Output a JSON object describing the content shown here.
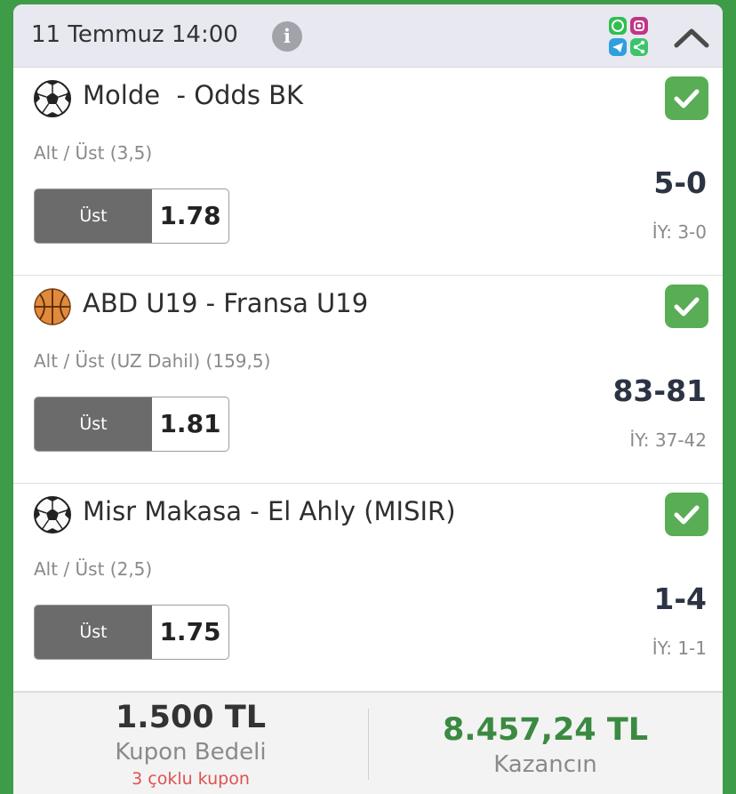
{
  "header": {
    "date": "11 Temmuz 14:00",
    "info_icon": "info-icon",
    "info_glyph": "i",
    "social_icon": "social-share-icons",
    "collapse_icon": "chevron-up-icon"
  },
  "matches": [
    {
      "sport": "football",
      "sport_icon": "soccer-ball-icon",
      "title": "Molde  - Odds BK",
      "market": "Alt / Üst (3,5)",
      "pick": "Üst",
      "odds": "1.78",
      "score": "5-0",
      "ht_score": "İY: 3-0",
      "status": "won"
    },
    {
      "sport": "basketball",
      "sport_icon": "basketball-icon",
      "title": "ABD U19 - Fransa U19",
      "market": "Alt / Üst (UZ Dahil) (159,5)",
      "pick": "Üst",
      "odds": "1.81",
      "score": "83-81",
      "ht_score": "İY: 37-42",
      "status": "won"
    },
    {
      "sport": "football",
      "sport_icon": "soccer-ball-icon",
      "title": "Misr Makasa - El Ahly (MISIR)",
      "market": "Alt / Üst (2,5)",
      "pick": "Üst",
      "odds": "1.75",
      "score": "1-4",
      "ht_score": "İY: 1-1",
      "status": "won"
    }
  ],
  "footer": {
    "stake_amount": "1.500 TL",
    "stake_label": "Kupon Bedeli",
    "coupon_count": "3 çoklu kupon",
    "win_amount": "8.457,24 TL",
    "win_label": "Kazancın"
  },
  "colors": {
    "background": "#3e9b47",
    "header_bg": "#e8e8f1",
    "check_green": "#59ad55",
    "win_green": "#3b8a41",
    "pick_label_bg": "#6b6b6b",
    "coupon_red": "#e05151"
  }
}
